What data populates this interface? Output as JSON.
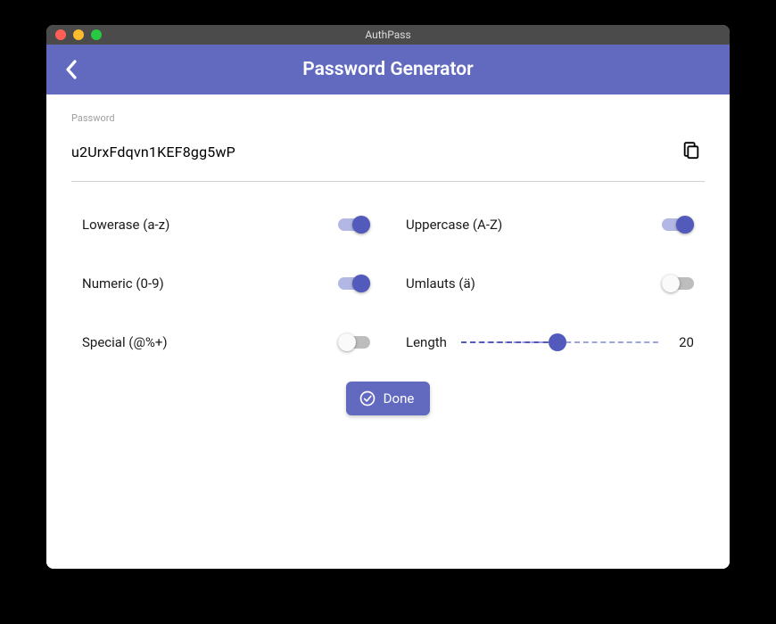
{
  "window": {
    "title": "AuthPass"
  },
  "appbar": {
    "title": "Password Generator"
  },
  "password": {
    "label": "Password",
    "value": "u2UrxFdqvn1KEF8gg5wP"
  },
  "options": {
    "lowercase": {
      "label": "Lowerase (a-z)",
      "on": true
    },
    "uppercase": {
      "label": "Uppercase (A-Z)",
      "on": true
    },
    "numeric": {
      "label": "Numeric (0-9)",
      "on": true
    },
    "umlauts": {
      "label": "Umlauts (ä)",
      "on": false
    },
    "special": {
      "label": "Special (@%+)",
      "on": false
    },
    "length": {
      "label": "Length",
      "value": 20,
      "min": 1,
      "max": 40
    }
  },
  "buttons": {
    "done": "Done"
  },
  "icons": {
    "back": "chevron-left-icon",
    "copy": "copy-icon",
    "check": "check-circle-icon"
  },
  "colors": {
    "accent": "#626ac0",
    "accent_dark": "#525bbb"
  }
}
